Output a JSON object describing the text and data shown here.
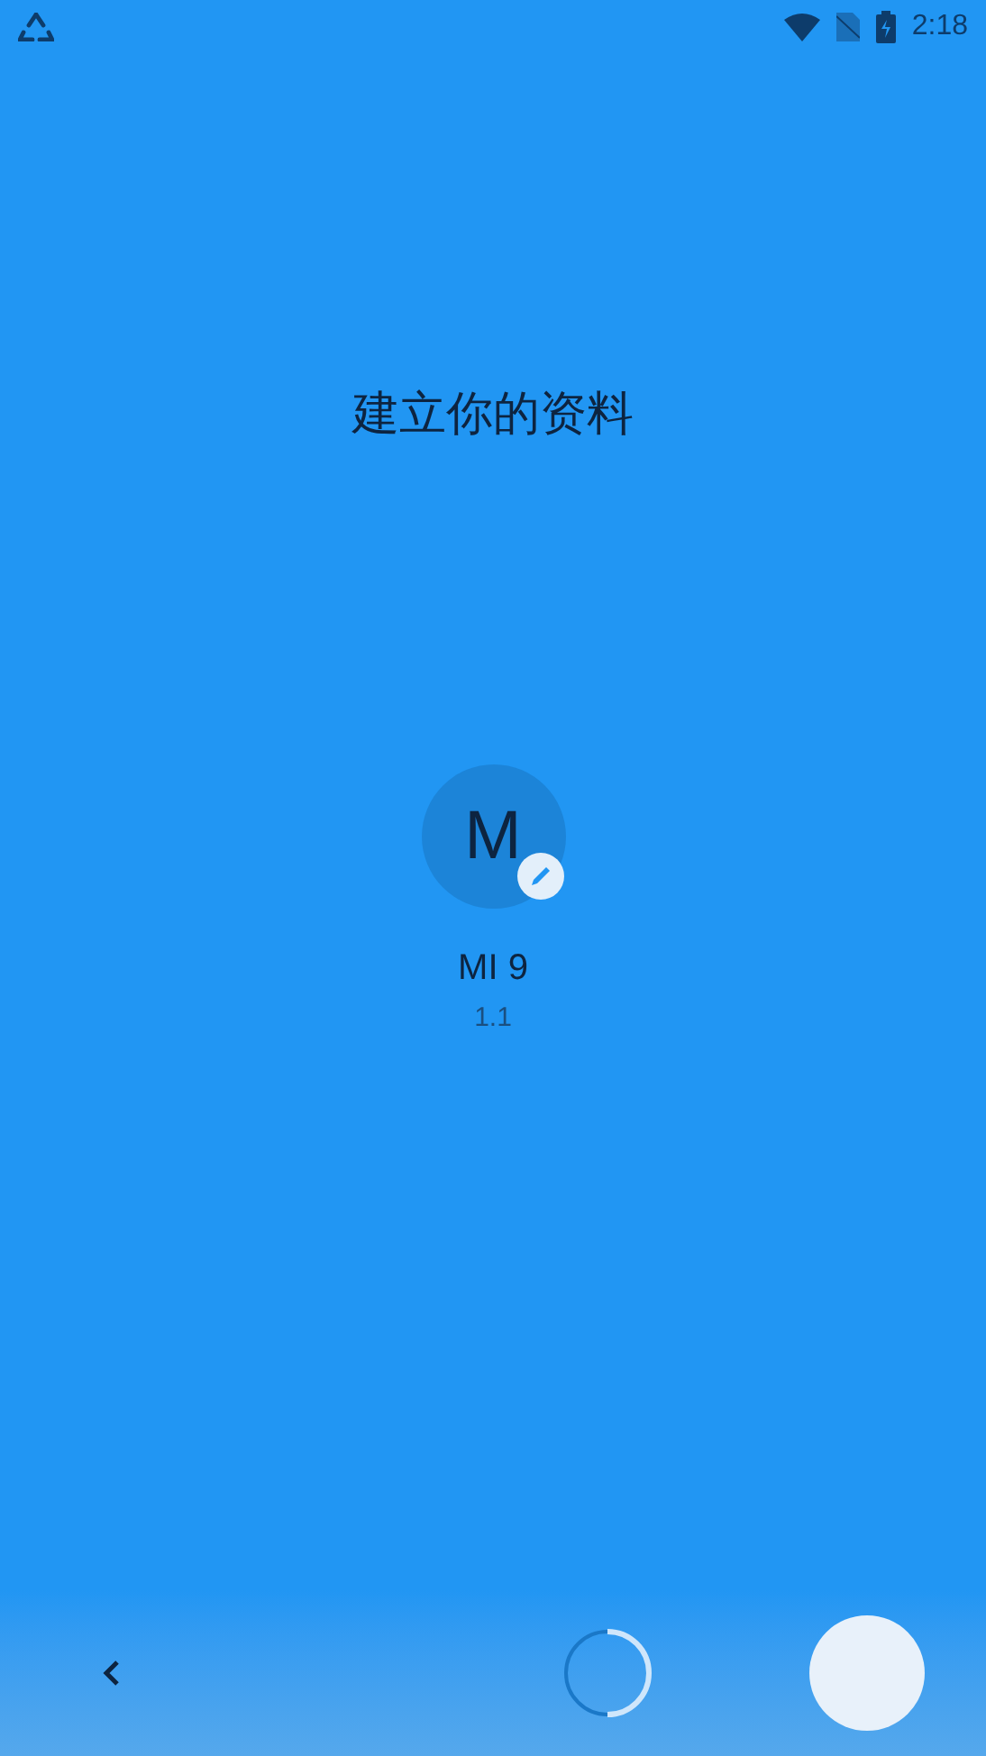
{
  "status_bar": {
    "time": "2:18"
  },
  "title": "建立你的资料",
  "profile": {
    "initial": "M",
    "name": "MI 9",
    "version": "1.1"
  }
}
